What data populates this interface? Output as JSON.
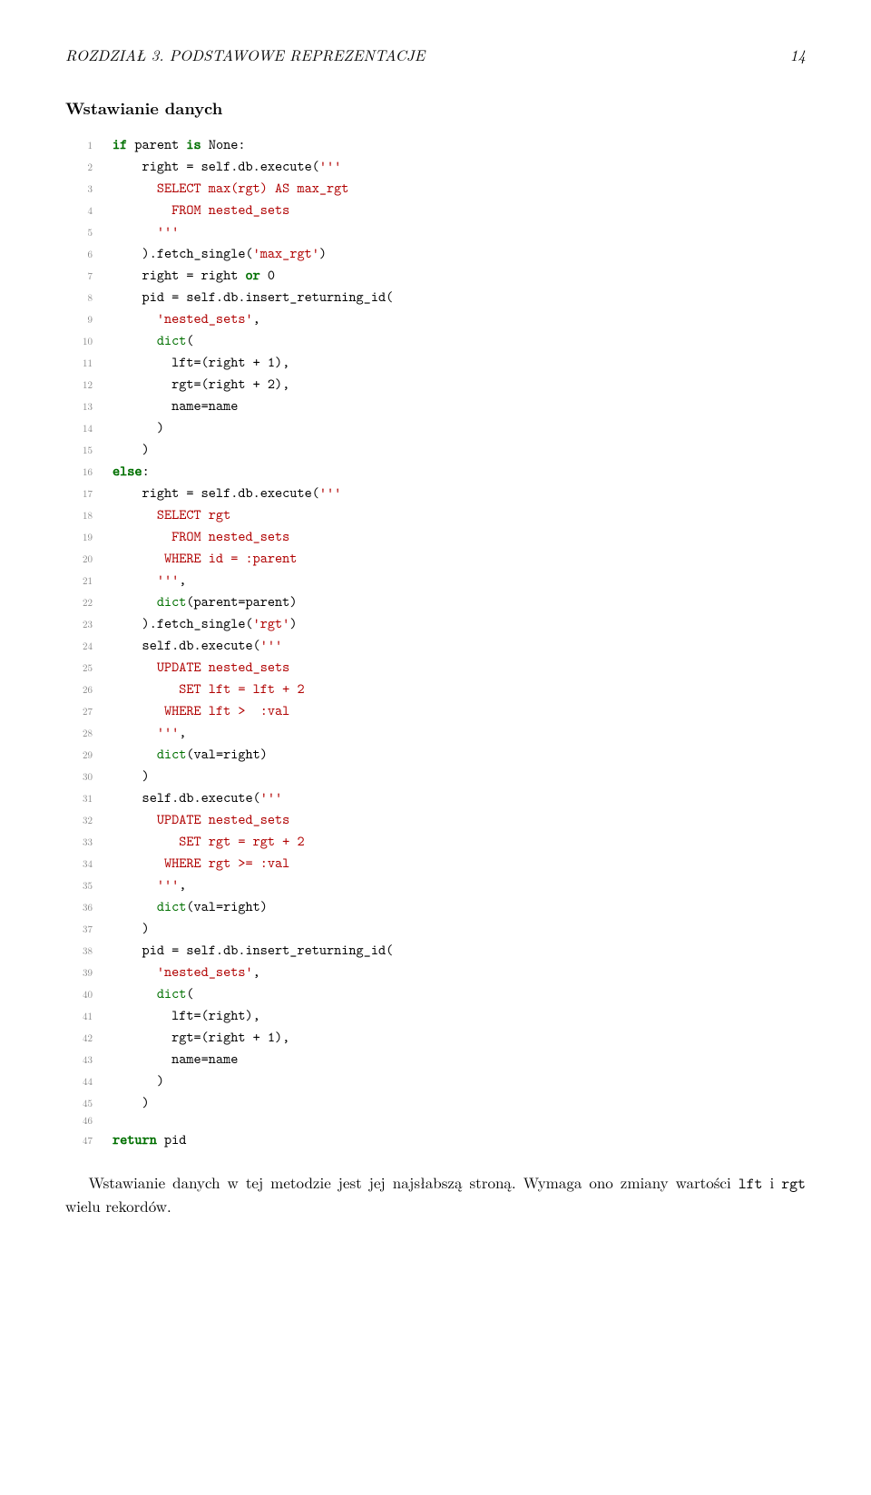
{
  "header": {
    "left": "ROZDZIAŁ 3.  PODSTAWOWE REPREZENTACJE",
    "right": "14"
  },
  "section_heading": "Wstawianie danych",
  "code": {
    "lines": [
      [
        {
          "t": "if ",
          "c": "kw"
        },
        {
          "t": "parent "
        },
        {
          "t": "is ",
          "c": "kw"
        },
        {
          "t": "None:"
        }
      ],
      [
        {
          "t": "    right = self.db.execute("
        },
        {
          "t": "'''",
          "c": "str"
        }
      ],
      [
        {
          "t": "      SELECT max(rgt) AS max_rgt",
          "c": "str"
        }
      ],
      [
        {
          "t": "        FROM nested_sets",
          "c": "str"
        }
      ],
      [
        {
          "t": "      '''",
          "c": "str"
        }
      ],
      [
        {
          "t": "    ).fetch_single("
        },
        {
          "t": "'max_rgt'",
          "c": "str"
        },
        {
          "t": ")"
        }
      ],
      [
        {
          "t": "    right = right "
        },
        {
          "t": "or ",
          "c": "kw"
        },
        {
          "t": "0"
        }
      ],
      [
        {
          "t": "    pid = self.db.insert_returning_id("
        }
      ],
      [
        {
          "t": "      "
        },
        {
          "t": "'nested_sets'",
          "c": "str"
        },
        {
          "t": ","
        }
      ],
      [
        {
          "t": "      "
        },
        {
          "t": "dict",
          "c": "bi"
        },
        {
          "t": "("
        }
      ],
      [
        {
          "t": "        lft=(right + 1),"
        }
      ],
      [
        {
          "t": "        rgt=(right + 2),"
        }
      ],
      [
        {
          "t": "        name=name"
        }
      ],
      [
        {
          "t": "      )"
        }
      ],
      [
        {
          "t": "    )"
        }
      ],
      [
        {
          "t": "else",
          "c": "kw"
        },
        {
          "t": ":"
        }
      ],
      [
        {
          "t": "    right = self.db.execute("
        },
        {
          "t": "'''",
          "c": "str"
        }
      ],
      [
        {
          "t": "      SELECT rgt",
          "c": "str"
        }
      ],
      [
        {
          "t": "        FROM nested_sets",
          "c": "str"
        }
      ],
      [
        {
          "t": "       WHERE id = :parent",
          "c": "str"
        }
      ],
      [
        {
          "t": "      '''",
          "c": "str"
        },
        {
          "t": ","
        }
      ],
      [
        {
          "t": "      "
        },
        {
          "t": "dict",
          "c": "bi"
        },
        {
          "t": "(parent=parent)"
        }
      ],
      [
        {
          "t": "    ).fetch_single("
        },
        {
          "t": "'rgt'",
          "c": "str"
        },
        {
          "t": ")"
        }
      ],
      [
        {
          "t": "    self.db.execute("
        },
        {
          "t": "'''",
          "c": "str"
        }
      ],
      [
        {
          "t": "      UPDATE nested_sets",
          "c": "str"
        }
      ],
      [
        {
          "t": "         SET lft = lft + 2",
          "c": "str"
        }
      ],
      [
        {
          "t": "       WHERE lft >  :val",
          "c": "str"
        }
      ],
      [
        {
          "t": "      '''",
          "c": "str"
        },
        {
          "t": ","
        }
      ],
      [
        {
          "t": "      "
        },
        {
          "t": "dict",
          "c": "bi"
        },
        {
          "t": "(val=right)"
        }
      ],
      [
        {
          "t": "    )"
        }
      ],
      [
        {
          "t": "    self.db.execute("
        },
        {
          "t": "'''",
          "c": "str"
        }
      ],
      [
        {
          "t": "      UPDATE nested_sets",
          "c": "str"
        }
      ],
      [
        {
          "t": "         SET rgt = rgt + 2",
          "c": "str"
        }
      ],
      [
        {
          "t": "       WHERE rgt >= :val",
          "c": "str"
        }
      ],
      [
        {
          "t": "      '''",
          "c": "str"
        },
        {
          "t": ","
        }
      ],
      [
        {
          "t": "      "
        },
        {
          "t": "dict",
          "c": "bi"
        },
        {
          "t": "(val=right)"
        }
      ],
      [
        {
          "t": "    )"
        }
      ],
      [
        {
          "t": "    pid = self.db.insert_returning_id("
        }
      ],
      [
        {
          "t": "      "
        },
        {
          "t": "'nested_sets'",
          "c": "str"
        },
        {
          "t": ","
        }
      ],
      [
        {
          "t": "      "
        },
        {
          "t": "dict",
          "c": "bi"
        },
        {
          "t": "("
        }
      ],
      [
        {
          "t": "        lft=(right),"
        }
      ],
      [
        {
          "t": "        rgt=(right + 1),"
        }
      ],
      [
        {
          "t": "        name=name"
        }
      ],
      [
        {
          "t": "      )"
        }
      ],
      [
        {
          "t": "    )"
        }
      ],
      [
        {
          "t": ""
        }
      ],
      [
        {
          "t": "return ",
          "c": "kw"
        },
        {
          "t": "pid"
        }
      ]
    ]
  },
  "para": {
    "pre": "Wstawianie danych w tej metodzie jest jej najsłabszą stroną. Wymaga ono zmiany wartości ",
    "tt1": "lft",
    "mid": " i ",
    "tt2": "rgt",
    "post": " wielu rekordów."
  }
}
